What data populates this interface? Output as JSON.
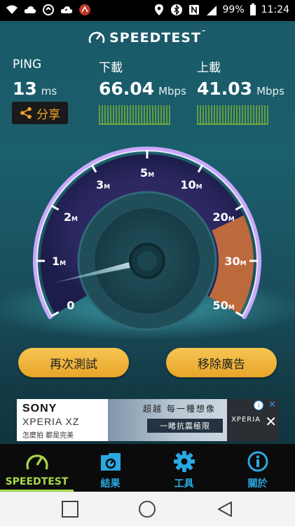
{
  "status_bar": {
    "battery": "99%",
    "time": "11:24"
  },
  "header": {
    "app_name": "SPEEDTEST",
    "trademark": "™"
  },
  "metrics": {
    "ping": {
      "label": "PING",
      "value": "13",
      "unit": "ms"
    },
    "download": {
      "label": "下載",
      "value": "66.04",
      "unit": "Mbps"
    },
    "upload": {
      "label": "上載",
      "value": "41.03",
      "unit": "Mbps"
    }
  },
  "share_label": "分享",
  "gauge": {
    "labels": [
      {
        "num": "0",
        "unit": ""
      },
      {
        "num": "1",
        "unit": "M"
      },
      {
        "num": "2",
        "unit": "M"
      },
      {
        "num": "3",
        "unit": "M"
      },
      {
        "num": "5",
        "unit": "M"
      },
      {
        "num": "10",
        "unit": "M"
      },
      {
        "num": "20",
        "unit": "M"
      },
      {
        "num": "30",
        "unit": "M"
      },
      {
        "num": "50",
        "unit": "M"
      }
    ],
    "needle_fraction": 0.07,
    "arc_color": "#c9a8ff",
    "range_fill_color": "#d8773a"
  },
  "buttons": {
    "retest": "再次測試",
    "remove_ads": "移除廣告"
  },
  "ad": {
    "brand": "SONY",
    "product": "XPERIA XZ",
    "tagline": "怎麼拍 都是完美",
    "headline": "超越 每一種想像",
    "cta": "一睹抗震極限",
    "right_brand": "XPERIA"
  },
  "nav": {
    "items": [
      {
        "label": "SPEEDTEST",
        "icon": "gauge-icon"
      },
      {
        "label": "結果",
        "icon": "results-icon"
      },
      {
        "label": "工具",
        "icon": "gear-icon"
      },
      {
        "label": "關於",
        "icon": "info-icon"
      }
    ],
    "active_color": "#a8d94a",
    "inactive_color": "#2aa8e0"
  }
}
